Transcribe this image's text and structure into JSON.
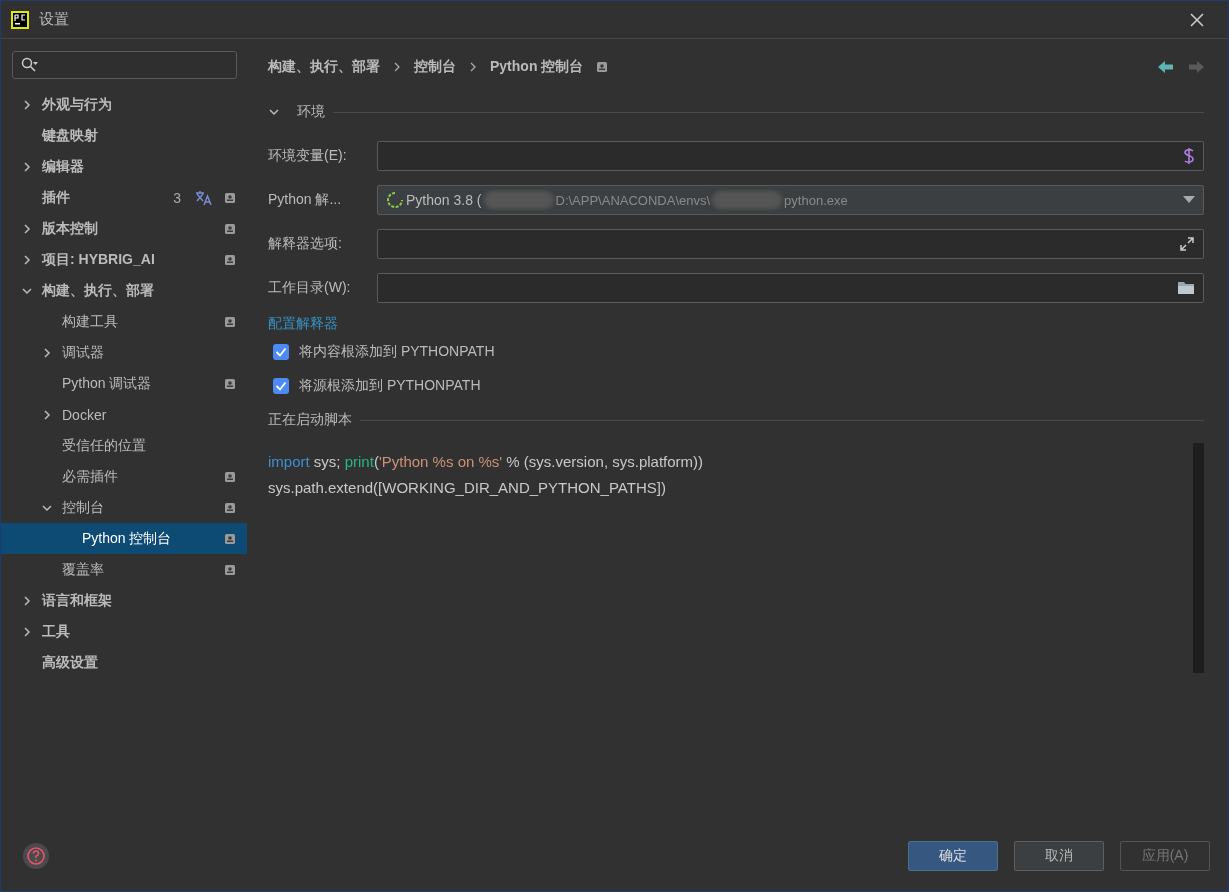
{
  "window": {
    "title": "设置"
  },
  "sidebar": {
    "items": [
      {
        "label": "外观与行为",
        "expanded": false,
        "selected": false
      },
      {
        "label": "键盘映射",
        "selected": false
      },
      {
        "label": "编辑器",
        "expanded": false,
        "selected": false
      },
      {
        "label": "插件",
        "count": "3",
        "translate_icon": true,
        "project_icon": true,
        "selected": false
      },
      {
        "label": "版本控制",
        "expanded": false,
        "project_icon": true,
        "selected": false
      },
      {
        "label": "项目: HYBRIG_AI",
        "expanded": false,
        "project_icon": true,
        "selected": false
      },
      {
        "label": "构建、执行、部署",
        "expanded": true,
        "selected": false,
        "children": [
          {
            "label": "构建工具",
            "project_icon": true,
            "selected": false
          },
          {
            "label": "调试器",
            "expanded": false,
            "selected": false
          },
          {
            "label": "Python 调试器",
            "project_icon": true,
            "selected": false
          },
          {
            "label": "Docker",
            "expanded": false,
            "selected": false
          },
          {
            "label": "受信任的位置",
            "selected": false
          },
          {
            "label": "必需插件",
            "project_icon": true,
            "selected": false
          },
          {
            "label": "控制台",
            "expanded": true,
            "project_icon": true,
            "selected": false,
            "children": [
              {
                "label": "Python 控制台",
                "project_icon": true,
                "selected": true
              }
            ]
          },
          {
            "label": "覆盖率",
            "project_icon": true,
            "selected": false
          }
        ]
      },
      {
        "label": "语言和框架",
        "expanded": false,
        "selected": false
      },
      {
        "label": "工具",
        "expanded": false,
        "selected": false
      },
      {
        "label": "高级设置",
        "selected": false
      }
    ]
  },
  "breadcrumb": [
    "构建、执行、部署",
    "控制台",
    "Python 控制台"
  ],
  "sections": [
    {
      "title": "环境",
      "expanded": true
    }
  ],
  "fields": [
    {
      "label": "环境变量(E):",
      "kind": "dollar"
    },
    {
      "label": "Python 解...",
      "kind": "interpreter",
      "name": "Python 3.8 (",
      "path": "D:\\APP\\ANACONDA\\envs\\",
      "file": "python.exe"
    },
    {
      "label": "解释器选项:",
      "kind": "expand"
    },
    {
      "label": "工作目录(W):",
      "kind": "folder"
    }
  ],
  "link": "配置解释器",
  "checkboxes": [
    {
      "label": "将内容根添加到 PYTHONPATH",
      "checked": true
    },
    {
      "label": "将源根添加到 PYTHONPATH",
      "checked": true
    }
  ],
  "script": {
    "title": "正在启动脚本",
    "lines": [
      [
        {
          "text": "import",
          "kind": "keyword"
        },
        {
          "text": " sys; ",
          "kind": "plain"
        },
        {
          "text": "print",
          "kind": "builtin"
        },
        {
          "text": "(",
          "kind": "plain"
        },
        {
          "text": "'Python %s on %s'",
          "kind": "string"
        },
        {
          "text": " % (sys.version, sys.platform))",
          "kind": "plain"
        }
      ],
      [
        {
          "text": "sys.path.extend([WORKING_DIR_AND_PYTHON_PATHS])",
          "kind": "plain"
        }
      ]
    ]
  },
  "buttons": [
    {
      "label": "确定",
      "kind": "primary",
      "disabled": false
    },
    {
      "label": "取消",
      "kind": "normal",
      "disabled": false
    },
    {
      "label": "应用(A)",
      "kind": "normal",
      "disabled": true
    }
  ]
}
